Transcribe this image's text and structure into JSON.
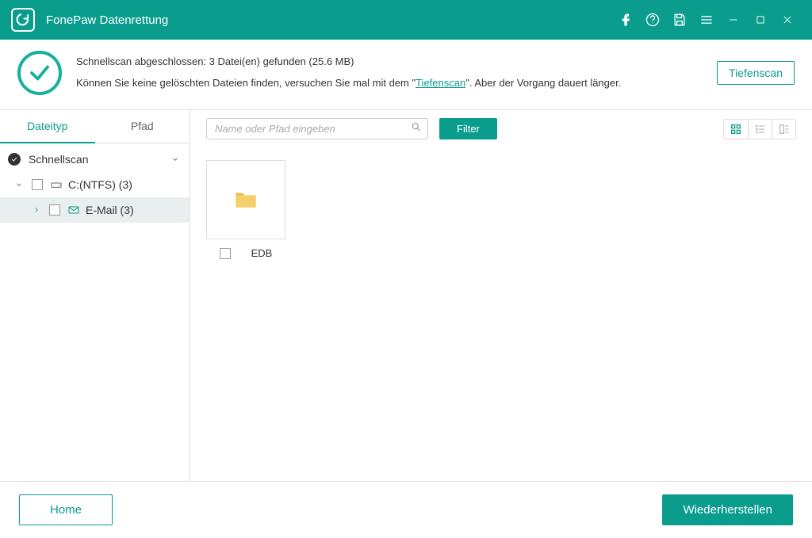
{
  "app_title": "FonePaw Datenrettung",
  "status": {
    "line1": "Schnellscan abgeschlossen: 3 Datei(en) gefunden (25.6 MB)",
    "line2_a": "Können Sie keine gelöschten Dateien finden, versuchen Sie mal mit dem \"",
    "deepscan_link": "Tiefenscan",
    "line2_b": "\". Aber der Vorgang dauert länger.",
    "deepscan_button": "Tiefenscan"
  },
  "tabs": {
    "filetype": "Dateityp",
    "path": "Pfad"
  },
  "tree": {
    "root": "Schnellscan",
    "drive": "C:(NTFS) (3)",
    "email": "E-Mail (3)"
  },
  "toolbar": {
    "search_placeholder": "Name oder Pfad eingeben",
    "filter_label": "Filter"
  },
  "items": [
    {
      "label": "EDB"
    }
  ],
  "footer": {
    "home": "Home",
    "recover": "Wiederherstellen"
  }
}
